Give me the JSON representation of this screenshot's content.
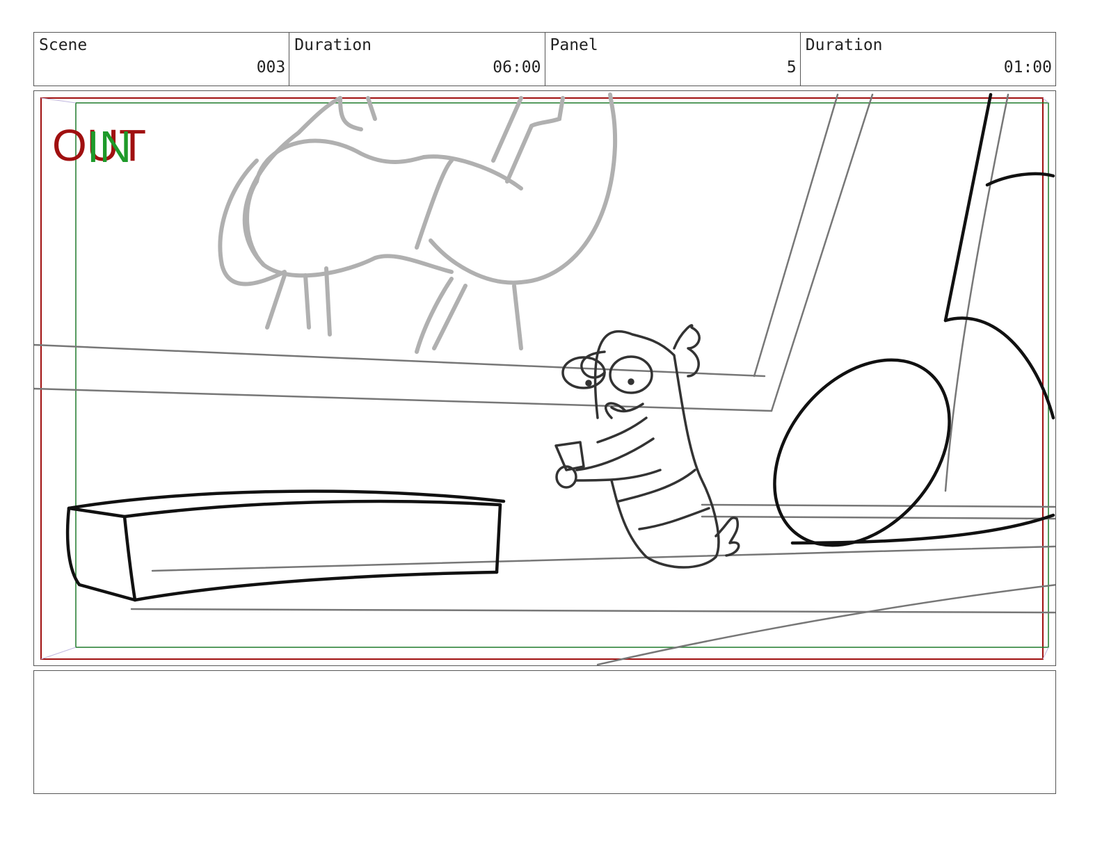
{
  "header": {
    "scene_label": "Scene",
    "scene_value": "003",
    "scene_duration_label": "Duration",
    "scene_duration_value": "06:00",
    "panel_label": "Panel",
    "panel_value": "5",
    "panel_duration_label": "Duration",
    "panel_duration_value": "01:00"
  },
  "frame": {
    "out_label": "OUT",
    "in_label": "IN",
    "out_color": "#a01010",
    "in_color": "#1e9a2a"
  },
  "notes": {
    "text": ""
  }
}
